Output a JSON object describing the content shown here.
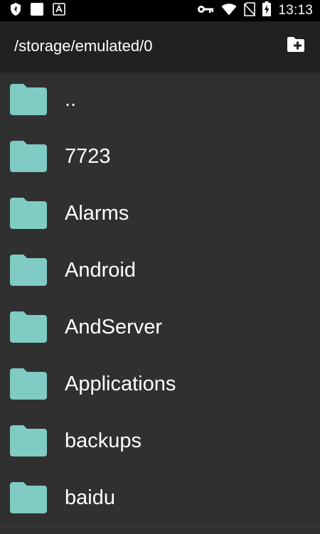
{
  "status_bar": {
    "time": "13:13",
    "left_icons": [
      "shield-icon",
      "white-square-icon",
      "font-a-icon"
    ],
    "right_icons": [
      "key-icon",
      "wifi-icon",
      "no-sim-icon",
      "battery-charging-icon"
    ]
  },
  "toolbar": {
    "path": "/storage/emulated/0",
    "new_folder_icon": "create-new-folder-icon"
  },
  "colors": {
    "background": "#303030",
    "toolbar": "#212121",
    "folder": "#80CBC4",
    "text": "#FFFFFF"
  },
  "files": [
    {
      "name": ".."
    },
    {
      "name": "7723"
    },
    {
      "name": "Alarms"
    },
    {
      "name": "Android"
    },
    {
      "name": "AndServer"
    },
    {
      "name": "Applications"
    },
    {
      "name": "backups"
    },
    {
      "name": "baidu"
    }
  ]
}
